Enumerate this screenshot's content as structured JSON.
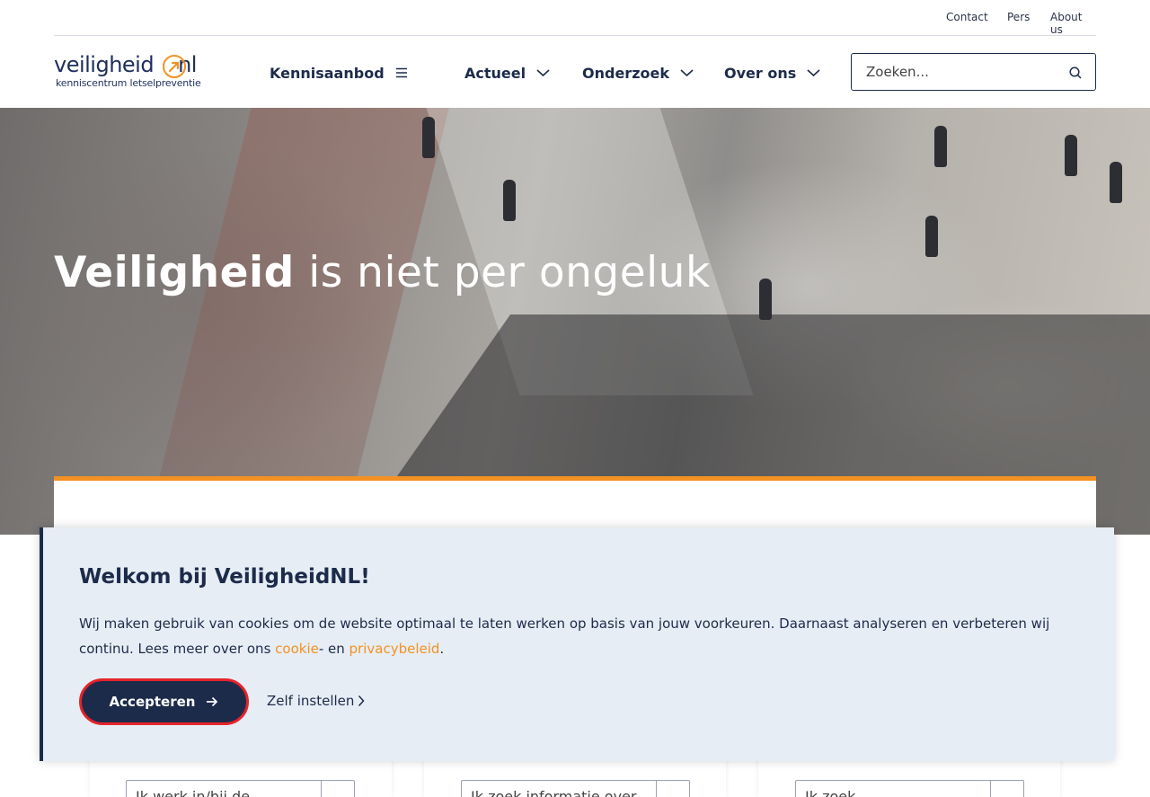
{
  "topbar": {
    "links": [
      "Contact",
      "Pers",
      "About us"
    ]
  },
  "logo": {
    "name_part1": "veiligheid",
    "name_part2": "nl",
    "tagline": "kenniscentrum letselpreventie"
  },
  "nav": {
    "items": [
      "Kennisaanbod",
      "Actueel",
      "Onderzoek",
      "Over ons"
    ]
  },
  "search": {
    "placeholder": "Zoeken..."
  },
  "hero": {
    "title_strong": "Veiligheid",
    "title_rest": " is niet per ongeluk"
  },
  "cards": {
    "selects": [
      "Ik werk in/bij de",
      "Ik zoek informatie over",
      "Ik zoek"
    ]
  },
  "cookie": {
    "title": "Welkom bij VeiligheidNL!",
    "text_before": "Wij maken gebruik van cookies om de website optimaal te laten werken op basis van jouw voorkeuren. Daarnaast analyseren en verbeteren wij continu. Lees meer over ons ",
    "cookie_link": "cookie",
    "text_middle": "- en ",
    "privacy_link": "privacybeleid",
    "text_end": ".",
    "accept_label": "Accepteren",
    "settings_label": "Zelf instellen"
  },
  "colors": {
    "navy": "#1d2b4a",
    "accent": "#f39222",
    "accept_border": "#e5242a",
    "cookie_bg": "#e6edf5"
  }
}
